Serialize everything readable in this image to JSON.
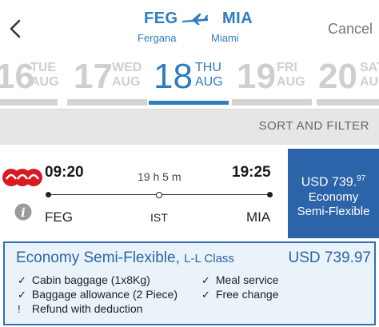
{
  "header": {
    "origin_code": "FEG",
    "origin_city": "Fergana",
    "destination_code": "MIA",
    "destination_city": "Miami",
    "cancel_label": "Cancel"
  },
  "dates": [
    {
      "day": "16",
      "weekday": "TUE",
      "month": "AUG",
      "selected": false
    },
    {
      "day": "17",
      "weekday": "WED",
      "month": "AUG",
      "selected": false
    },
    {
      "day": "18",
      "weekday": "THU",
      "month": "AUG",
      "selected": true
    },
    {
      "day": "19",
      "weekday": "FRI",
      "month": "AUG",
      "selected": false
    },
    {
      "day": "20",
      "weekday": "SAT",
      "month": "AUG",
      "selected": false
    }
  ],
  "sort_filter_label": "SORT AND FILTER",
  "flight": {
    "departure_time": "09:20",
    "arrival_time": "19:25",
    "duration": "19 h 5 m",
    "origin": "FEG",
    "stop": "IST",
    "destination": "MIA",
    "price_main": "USD 739.",
    "price_cents": "97",
    "fare_line1": "Economy",
    "fare_line2": "Semi-Flexible"
  },
  "fare_details": {
    "title": "Economy Semi-Flexible,",
    "class": "L-L Class",
    "price": "USD 739.97",
    "features": [
      {
        "mark": "✓",
        "text": "Cabin baggage (1x8Kg)"
      },
      {
        "mark": "✓",
        "text": "Meal service"
      },
      {
        "mark": "✓",
        "text": "Baggage allowance (2 Piece)"
      },
      {
        "mark": "✓",
        "text": "Free change"
      },
      {
        "mark": "!",
        "text": "Refund with deduction"
      }
    ]
  },
  "colors": {
    "brand_blue": "#2f7cbf",
    "price_box": "#2b64a8",
    "airline_red": "#d71920"
  }
}
